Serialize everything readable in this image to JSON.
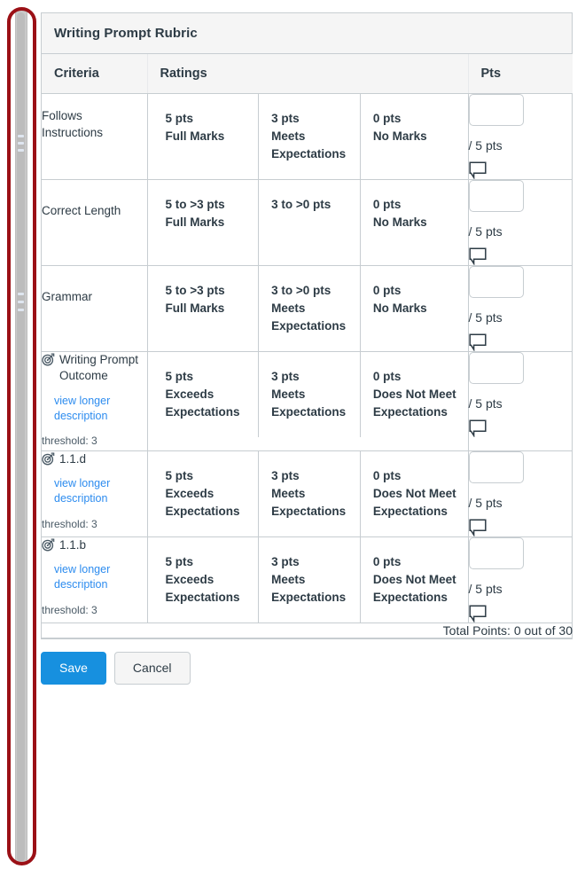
{
  "rubric": {
    "title": "Writing Prompt Rubric",
    "columns": {
      "criteria": "Criteria",
      "ratings": "Ratings",
      "pts": "Pts"
    },
    "view_longer_description_label": "view longer\ndescription",
    "view_longer_line1": "view longer",
    "view_longer_line2": "description",
    "rows": [
      {
        "criterion": "Follows Instructions",
        "is_outcome": false,
        "ratings": [
          {
            "points": "5 pts",
            "desc": "Full Marks"
          },
          {
            "points": "3 pts",
            "desc": "Meets Expectations"
          },
          {
            "points": "0 pts",
            "desc": "No Marks"
          }
        ],
        "pts_value": "",
        "pts_possible": "/ 5 pts"
      },
      {
        "criterion": "Correct Length",
        "is_outcome": false,
        "ratings": [
          {
            "points": "5 to >3 pts",
            "desc": "Full Marks"
          },
          {
            "points": "3 to >0 pts",
            "desc": ""
          },
          {
            "points": "0 pts",
            "desc": "No Marks"
          }
        ],
        "pts_value": "",
        "pts_possible": "/ 5 pts"
      },
      {
        "criterion": "Grammar",
        "is_outcome": false,
        "ratings": [
          {
            "points": "5 to >3 pts",
            "desc": "Full Marks"
          },
          {
            "points": "3 to >0 pts",
            "desc": "Meets Expectations"
          },
          {
            "points": "0 pts",
            "desc": "No Marks"
          }
        ],
        "pts_value": "",
        "pts_possible": "/ 5 pts"
      },
      {
        "criterion": "Writing Prompt Outcome",
        "is_outcome": true,
        "threshold": "threshold: 3",
        "ratings": [
          {
            "points": "5 pts",
            "desc": "Exceeds Expectations"
          },
          {
            "points": "3 pts",
            "desc": "Meets Expectations"
          },
          {
            "points": "0 pts",
            "desc": "Does Not Meet Expectations"
          }
        ],
        "pts_value": "",
        "pts_possible": "/ 5 pts"
      },
      {
        "criterion": "1.1.d",
        "is_outcome": true,
        "threshold": "threshold: 3",
        "ratings": [
          {
            "points": "5 pts",
            "desc": "Exceeds Expectations"
          },
          {
            "points": "3 pts",
            "desc": "Meets Expectations"
          },
          {
            "points": "0 pts",
            "desc": "Does Not Meet Expectations"
          }
        ],
        "pts_value": "",
        "pts_possible": "/ 5 pts"
      },
      {
        "criterion": "1.1.b",
        "is_outcome": true,
        "threshold": "threshold: 3",
        "ratings": [
          {
            "points": "5 pts",
            "desc": "Exceeds Expectations"
          },
          {
            "points": "3 pts",
            "desc": "Meets Expectations"
          },
          {
            "points": "0 pts",
            "desc": "Does Not Meet Expectations"
          }
        ],
        "pts_value": "",
        "pts_possible": "/ 5 pts"
      }
    ],
    "total_points": "Total Points: 0 out of 30"
  },
  "footer": {
    "save_label": "Save",
    "cancel_label": "Cancel"
  },
  "icons": {
    "outcome": "outcome-target-icon",
    "comment": "comment-bubble-icon"
  },
  "colors": {
    "accent_blue": "#1790DF",
    "link_blue": "#2D8CEF",
    "highlight_red": "#9B1016",
    "border_gray": "#C7CDD1",
    "header_bg": "#F5F5F5",
    "text": "#2D3B45"
  }
}
